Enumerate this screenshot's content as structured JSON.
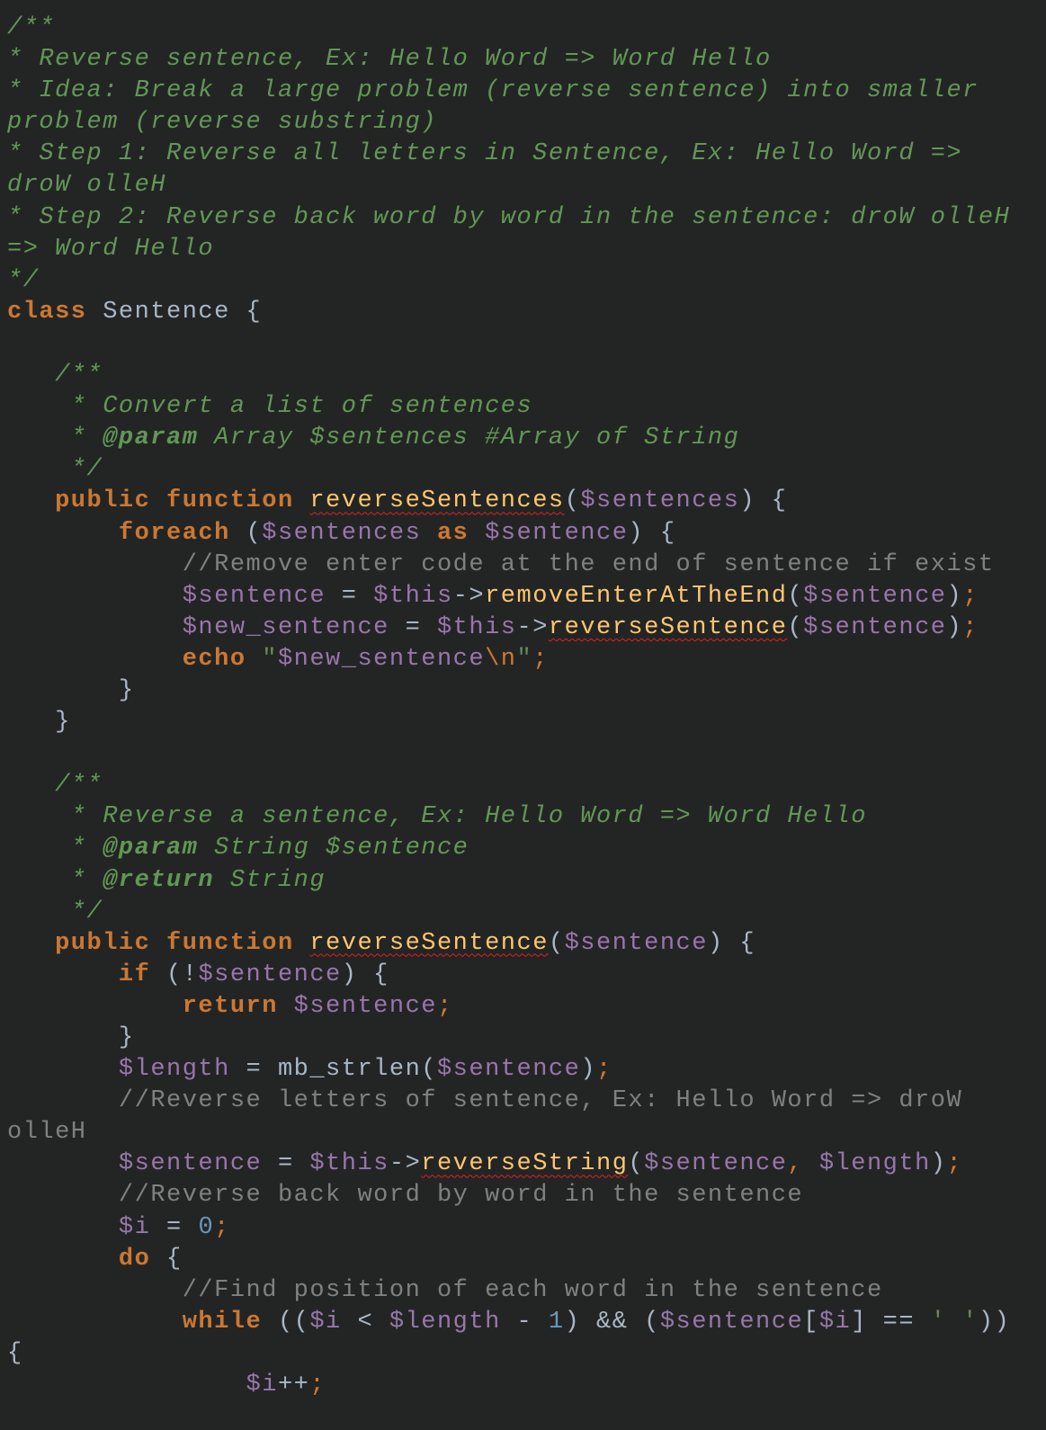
{
  "colors": {
    "background": "#232525",
    "keyword": "#cc7832",
    "variable": "#9876aa",
    "method": "#ffc66d",
    "comment": "#808080",
    "doc_comment": "#629755",
    "plain": "#a9b7c6",
    "number": "#6897bb",
    "string": "#6a8759",
    "spellcheck_underline": "#e02020"
  },
  "lines": [
    [
      [
        "d",
        "/**"
      ]
    ],
    [
      [
        "d",
        "* Reverse sentence, Ex: Hello Word => Word Hello"
      ]
    ],
    [
      [
        "d",
        "* Idea: Break a large problem (reverse sentence) into smaller"
      ]
    ],
    [
      [
        "d",
        "problem (reverse substring)"
      ]
    ],
    [
      [
        "d",
        "* Step 1: Reverse all letters in Sentence, Ex: Hello Word =>"
      ]
    ],
    [
      [
        "d",
        "droW olleH"
      ]
    ],
    [
      [
        "d",
        "* Step 2: Reverse back word by word in the sentence: droW olleH"
      ]
    ],
    [
      [
        "d",
        "=> Word Hello"
      ]
    ],
    [
      [
        "d",
        "*/"
      ]
    ],
    [
      [
        "k",
        "class"
      ],
      [
        "p",
        " Sentence {"
      ]
    ],
    [],
    [
      [
        "d",
        "   /**"
      ]
    ],
    [
      [
        "d",
        "    * Convert a list of sentences"
      ]
    ],
    [
      [
        "d",
        "    * "
      ],
      [
        "dt",
        "@param"
      ],
      [
        "d",
        " Array $sentences #Array of String"
      ]
    ],
    [
      [
        "d",
        "    */"
      ]
    ],
    [
      [
        "p",
        "   "
      ],
      [
        "k",
        "public function"
      ],
      [
        "p",
        " "
      ],
      [
        "u",
        "reverseSentences"
      ],
      [
        "p",
        "("
      ],
      [
        "v",
        "$sentences"
      ],
      [
        "p",
        ") {"
      ]
    ],
    [
      [
        "p",
        "       "
      ],
      [
        "k",
        "foreach"
      ],
      [
        "p",
        " ("
      ],
      [
        "v",
        "$sentences"
      ],
      [
        "p",
        " "
      ],
      [
        "k",
        "as"
      ],
      [
        "p",
        " "
      ],
      [
        "v",
        "$sentence"
      ],
      [
        "p",
        ") {"
      ]
    ],
    [
      [
        "p",
        "           "
      ],
      [
        "c",
        "//Remove enter code at the end of sentence if exist"
      ]
    ],
    [
      [
        "p",
        "           "
      ],
      [
        "v",
        "$sentence"
      ],
      [
        "p",
        " = "
      ],
      [
        "v",
        "$this"
      ],
      [
        "p",
        "->"
      ],
      [
        "m",
        "removeEnterAtTheEnd"
      ],
      [
        "p",
        "("
      ],
      [
        "v",
        "$sentence"
      ],
      [
        "p",
        ")"
      ],
      [
        "o",
        ";"
      ]
    ],
    [
      [
        "p",
        "           "
      ],
      [
        "v",
        "$new_sentence"
      ],
      [
        "p",
        " = "
      ],
      [
        "v",
        "$this"
      ],
      [
        "p",
        "->"
      ],
      [
        "u",
        "reverseSentence"
      ],
      [
        "p",
        "("
      ],
      [
        "v",
        "$sentence"
      ],
      [
        "p",
        ")"
      ],
      [
        "o",
        ";"
      ]
    ],
    [
      [
        "p",
        "           "
      ],
      [
        "k",
        "echo"
      ],
      [
        "p",
        " "
      ],
      [
        "s",
        "\""
      ],
      [
        "v",
        "$new_sentence"
      ],
      [
        "o",
        "\\n"
      ],
      [
        "s",
        "\""
      ],
      [
        "o",
        ";"
      ]
    ],
    [
      [
        "p",
        "       }"
      ]
    ],
    [
      [
        "p",
        "   }"
      ]
    ],
    [],
    [
      [
        "d",
        "   /**"
      ]
    ],
    [
      [
        "d",
        "    * Reverse a sentence, Ex: Hello Word => Word Hello"
      ]
    ],
    [
      [
        "d",
        "    * "
      ],
      [
        "dt",
        "@param"
      ],
      [
        "d",
        " String $sentence"
      ]
    ],
    [
      [
        "d",
        "    * "
      ],
      [
        "dt",
        "@return"
      ],
      [
        "d",
        " String"
      ]
    ],
    [
      [
        "d",
        "    */"
      ]
    ],
    [
      [
        "p",
        "   "
      ],
      [
        "k",
        "public function"
      ],
      [
        "p",
        " "
      ],
      [
        "u",
        "reverseSentence"
      ],
      [
        "p",
        "("
      ],
      [
        "v",
        "$sentence"
      ],
      [
        "p",
        ") {"
      ]
    ],
    [
      [
        "p",
        "       "
      ],
      [
        "k",
        "if"
      ],
      [
        "p",
        " (!"
      ],
      [
        "v",
        "$sentence"
      ],
      [
        "p",
        ") {"
      ]
    ],
    [
      [
        "p",
        "           "
      ],
      [
        "k",
        "return"
      ],
      [
        "p",
        " "
      ],
      [
        "v",
        "$sentence"
      ],
      [
        "o",
        ";"
      ]
    ],
    [
      [
        "p",
        "       }"
      ]
    ],
    [
      [
        "p",
        "       "
      ],
      [
        "v",
        "$length"
      ],
      [
        "p",
        " = mb_strlen("
      ],
      [
        "v",
        "$sentence"
      ],
      [
        "p",
        ")"
      ],
      [
        "o",
        ";"
      ]
    ],
    [
      [
        "p",
        "       "
      ],
      [
        "c",
        "//Reverse letters of sentence, Ex: Hello Word => droW"
      ]
    ],
    [
      [
        "c",
        "olleH"
      ]
    ],
    [
      [
        "p",
        "       "
      ],
      [
        "v",
        "$sentence"
      ],
      [
        "p",
        " = "
      ],
      [
        "v",
        "$this"
      ],
      [
        "p",
        "->"
      ],
      [
        "u",
        "reverseString"
      ],
      [
        "p",
        "("
      ],
      [
        "v",
        "$sentence"
      ],
      [
        "o",
        ", "
      ],
      [
        "v",
        "$length"
      ],
      [
        "p",
        ")"
      ],
      [
        "o",
        ";"
      ]
    ],
    [
      [
        "p",
        "       "
      ],
      [
        "c",
        "//Reverse back word by word in the sentence"
      ]
    ],
    [
      [
        "p",
        "       "
      ],
      [
        "v",
        "$i"
      ],
      [
        "p",
        " = "
      ],
      [
        "n",
        "0"
      ],
      [
        "o",
        ";"
      ]
    ],
    [
      [
        "p",
        "       "
      ],
      [
        "k",
        "do"
      ],
      [
        "p",
        " {"
      ]
    ],
    [
      [
        "p",
        "           "
      ],
      [
        "c",
        "//Find position of each word in the sentence"
      ]
    ],
    [
      [
        "p",
        "           "
      ],
      [
        "k",
        "while"
      ],
      [
        "p",
        " (("
      ],
      [
        "v",
        "$i"
      ],
      [
        "p",
        " < "
      ],
      [
        "v",
        "$length"
      ],
      [
        "p",
        " - "
      ],
      [
        "n",
        "1"
      ],
      [
        "p",
        ") && ("
      ],
      [
        "v",
        "$sentence"
      ],
      [
        "p",
        "["
      ],
      [
        "v",
        "$i"
      ],
      [
        "p",
        "] == "
      ],
      [
        "s",
        "' '"
      ],
      [
        "p",
        "))"
      ]
    ],
    [
      [
        "p",
        "{"
      ]
    ],
    [
      [
        "p",
        "               "
      ],
      [
        "v",
        "$i"
      ],
      [
        "p",
        "++"
      ],
      [
        "o",
        ";"
      ]
    ]
  ]
}
